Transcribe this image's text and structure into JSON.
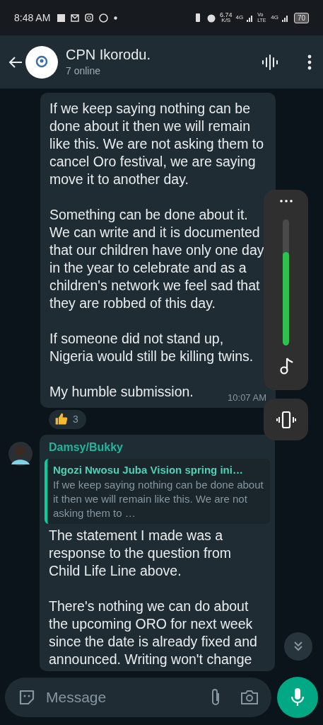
{
  "status_bar": {
    "time": "8:48 AM",
    "net_speed": "6.74",
    "net_unit": "K/S",
    "network_1": "4G",
    "volte": "Vo LTE",
    "network_2": "4G",
    "battery": "70"
  },
  "header": {
    "title": "CPN Ikorodu.",
    "subtitle": "7 online"
  },
  "messages": [
    {
      "kind": "text",
      "paragraphs": [
        "If we keep saying nothing can be done about it then we will remain like this. We are not asking them to cancel Oro festival, we are saying move it to another day.",
        "Something can be done about it. We can write and it is documented that our children have only one day in the year to celebrate and as a children's network we feel sad that they are robbed of this day.",
        "If someone did not stand up, Nigeria would still be killing twins.",
        "My humble submission."
      ],
      "time": "10:07 AM",
      "reaction_count": "3"
    },
    {
      "kind": "reply",
      "sender": "Damsy/Bukky",
      "quote": {
        "author": "Ngozi Nwosu Juba Vision spring ini…",
        "text": "If we keep saying nothing can be done about it then we will remain like this. We are not asking them to …"
      },
      "paragraphs": [
        "The statement I made was a response to the question from Child Life Line above.",
        "There's nothing we can do about the upcoming ORO for next week since the date is already fixed and announced. Writing won't change"
      ]
    }
  ],
  "volume_panel": {
    "level": 0.74
  },
  "composer": {
    "placeholder": "Message"
  }
}
